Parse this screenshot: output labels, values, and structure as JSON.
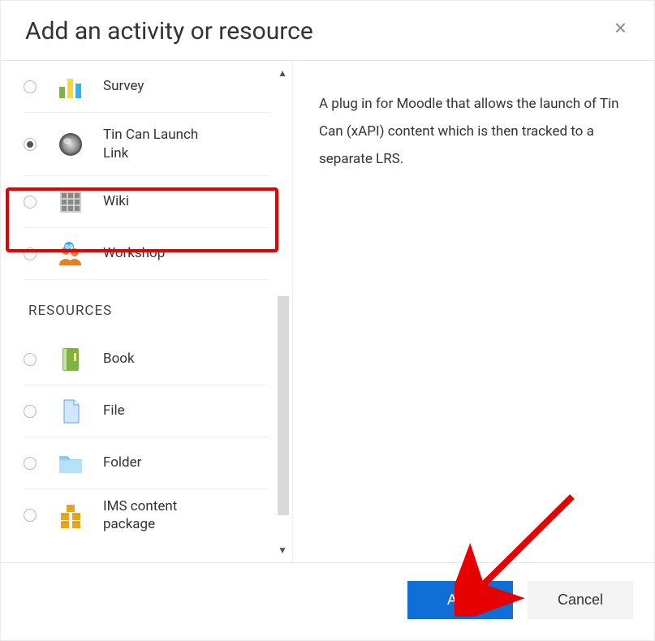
{
  "dialog": {
    "title": "Add an activity or resource",
    "close_label": "×"
  },
  "activities": [
    {
      "icon": "survey-icon",
      "label": "Survey",
      "selected": false
    },
    {
      "icon": "tincan-icon",
      "label": "Tin Can Launch Link",
      "selected": true
    },
    {
      "icon": "wiki-icon",
      "label": "Wiki",
      "selected": false
    },
    {
      "icon": "workshop-icon",
      "label": "Workshop",
      "selected": false
    }
  ],
  "resources_heading": "RESOURCES",
  "resources": [
    {
      "icon": "book-icon",
      "label": "Book",
      "selected": false
    },
    {
      "icon": "file-icon",
      "label": "File",
      "selected": false
    },
    {
      "icon": "folder-icon",
      "label": "Folder",
      "selected": false
    },
    {
      "icon": "ims-icon",
      "label": "IMS content package",
      "selected": false
    }
  ],
  "description": "A plug in for Moodle that allows the launch of Tin Can (xAPI) content which is then tracked to a separate LRS.",
  "footer": {
    "add_label": "Add",
    "cancel_label": "Cancel"
  },
  "annotations": {
    "highlight_item_index": 1,
    "arrow_target": "add-button"
  }
}
